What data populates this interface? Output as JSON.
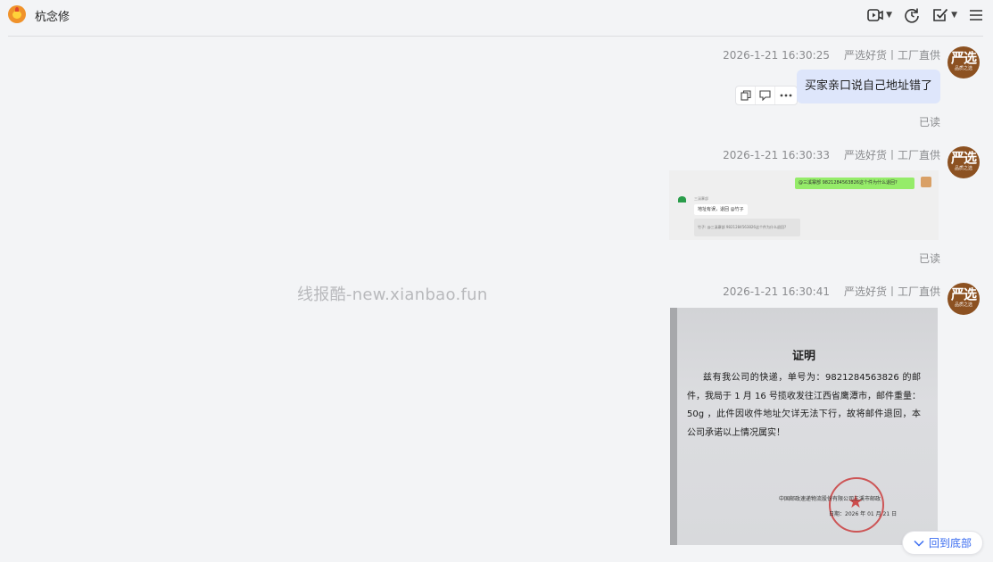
{
  "header": {
    "title": "杭念修",
    "tools": [
      {
        "icon": "video-call-icon",
        "has_caret": true
      },
      {
        "icon": "refresh-icon",
        "has_caret": false
      },
      {
        "icon": "task-check-icon",
        "has_caret": true
      },
      {
        "icon": "menu-icon",
        "has_caret": false
      }
    ]
  },
  "watermark": "线报酷-new.xianbao.fun",
  "messages": [
    {
      "timestamp": "2026-1-21 16:30:25",
      "sender": "严选好货丨工厂直供",
      "type": "text",
      "text": "买家亲口说自己地址错了",
      "status": "已读"
    },
    {
      "timestamp": "2026-1-21 16:30:33",
      "sender": "严选好货丨工厂直供",
      "type": "image",
      "image": {
        "green_bubble": "@三溪寨部 9821284563826这个件为什么退回?",
        "reply_name": "三溪寨部",
        "reply_text": "地址有误，退回 @竹子",
        "quote": "竹子: @三溪寨部 9821284563826这个件为什么退回?"
      },
      "status": "已读"
    },
    {
      "timestamp": "2026-1-21 16:30:41",
      "sender": "严选好货丨工厂直供",
      "type": "image",
      "image": {
        "doc_title": "证明",
        "doc_body": "兹有我公司的快递，单号为：9821284563826 的邮件，我局于 1 月 16 号揽收发往江西省鹰潭市，邮件重量：50g ，此件因收件地址欠详无法下行，故将邮件退回，本公司承诺以上情况属实！",
        "sign": "中国邮政速递物流股份有限公司三溪市邮政",
        "date": "日期：2026 年 01 月 21 日"
      }
    }
  ],
  "avatar": {
    "big": "严选",
    "small": "品质之选"
  },
  "action_icons": [
    "copy-icon",
    "quote-icon",
    "more-icon"
  ],
  "back_to_bottom": "回到底部",
  "colors": {
    "bubble": "#dee6fb",
    "accent": "#3a6cf0",
    "avatar": "#8c5121"
  }
}
